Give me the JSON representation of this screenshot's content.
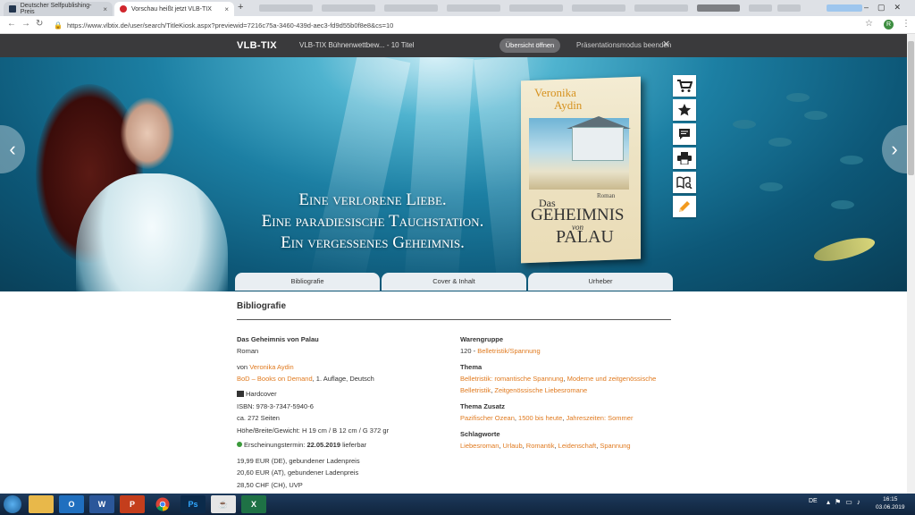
{
  "browser": {
    "tabs": [
      {
        "title": "Deutscher Selfpublishing-Preis",
        "close": "×"
      },
      {
        "title": "Vorschau heißt jetzt VLB-TIX",
        "close": "×"
      }
    ],
    "new_tab": "+",
    "url": "https://www.vlbtix.de/user/search/TitleKiosk.aspx?previewid=7216c75a-3460-439d-aec3-fd9d55b0f8e8&cs=10",
    "profile_initial": "R",
    "window_controls": "–▢✕"
  },
  "vlb": {
    "logo": "VLB-TIX",
    "title": "VLB-TIX Bühnenwettbew... - 10 Titel",
    "overview_button": "Übersicht öffnen",
    "presentation_end": "Präsentationsmodus beenden",
    "presentation_close": "✕"
  },
  "hero": {
    "tagline": [
      "Eine verlorene Liebe.",
      "Eine paradiesische Tauchstation.",
      "Ein vergessenes Geheimnis."
    ],
    "book": {
      "author_first": "Veronika",
      "author_last": "Aydin",
      "title_das": "Das",
      "title_main": "GEHEIMNIS",
      "title_von": "von",
      "title_palau": "PALAU",
      "genre": "Roman"
    },
    "actions": [
      "cart-icon",
      "star-icon",
      "comment-icon",
      "print-icon",
      "preview-icon",
      "edit-icon"
    ],
    "arrow_left": "‹",
    "arrow_right": "›"
  },
  "section_tabs": [
    "Bibliografie",
    "Cover & Inhalt",
    "Urheber"
  ],
  "bibliografie": {
    "heading": "Bibliografie",
    "title": "Das Geheimnis von Palau",
    "subtitle": "Roman",
    "by_prefix": "von ",
    "author": "Veronika Aydin",
    "publisher": "BoD – Books on Demand",
    "edition": ", 1. Auflage, Deutsch",
    "binding": "Hardcover",
    "isbn": "ISBN: 978-3-7347-5940-6",
    "pages": "ca. 272 Seiten",
    "dimensions": "Höhe/Breite/Gewicht: H 19 cm / B 12 cm / G 372 gr",
    "release_prefix": "Erscheinungstermin: ",
    "release_date": "22.05.2019",
    "release_suffix": " lieferbar",
    "prices": [
      "19,99 EUR (DE), gebundener Ladenpreis",
      "20,60 EUR (AT), gebundener Ladenpreis",
      "28,50 CHF (CH), UVP"
    ],
    "warengruppe_label": "Warengruppe",
    "warengruppe_code": "120 - ",
    "warengruppe_value": "Belletristik/Spannung",
    "thema_label": "Thema",
    "thema_1": "Belletristik: romantische Spannung",
    "thema_sep": ", ",
    "thema_2": "Moderne und zeitgenössische",
    "thema_3": "Belletristik",
    "thema_4": "Zeitgenössische Liebesromane",
    "thema_zusatz_label": "Thema Zusatz",
    "thema_zusatz": [
      "Pazifischer Ozean",
      "1500 bis heute",
      "Jahreszeiten: Sommer"
    ],
    "schlagworte_label": "Schlagworte",
    "schlagworte": [
      "Liebesroman",
      "Urlaub",
      "Romantik",
      "Leidenschaft",
      "Spannung"
    ]
  },
  "taskbar": {
    "apps": [
      "explorer",
      "outlook",
      "word",
      "powerpoint",
      "chrome",
      "photoshop",
      "java",
      "excel"
    ],
    "lang": "DE",
    "time": "16:15",
    "date": "03.06.2019"
  },
  "colors": {
    "link": "#e07a1f",
    "vlb_bar": "#3a3a3c",
    "available": "#3a9a3a"
  }
}
